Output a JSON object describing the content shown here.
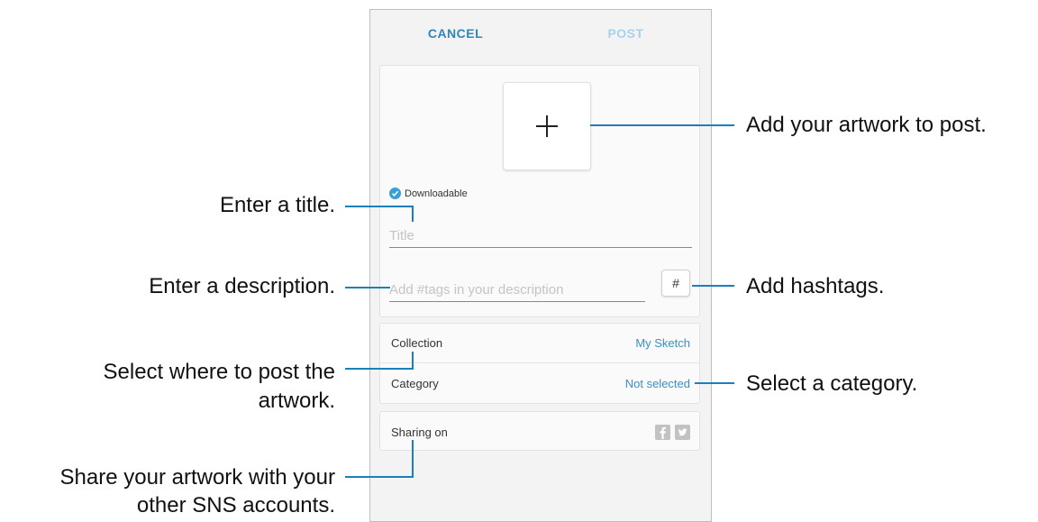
{
  "toolbar": {
    "cancel_label": "CANCEL",
    "post_label": "POST"
  },
  "form": {
    "add_icon": "plus-icon",
    "downloadable_label": "Downloadable",
    "downloadable_checked": true,
    "title_placeholder": "Title",
    "description_placeholder": "Add #tags in your description",
    "hashtag_button_label": "#"
  },
  "settings": {
    "collection_label": "Collection",
    "collection_value": "My Sketch",
    "category_label": "Category",
    "category_value": "Not selected",
    "sharing_label": "Sharing on",
    "sharing_icons": [
      "facebook-icon",
      "twitter-icon"
    ]
  },
  "callouts": {
    "add_artwork": "Add your artwork to post.",
    "enter_title": "Enter a title.",
    "enter_description": "Enter a description.",
    "add_hashtags": "Add hashtags.",
    "select_where_line1": "Select where to post the",
    "select_where_line2": "artwork.",
    "select_category": "Select a category.",
    "share_line1": "Share your artwork with your",
    "share_line2": "other SNS accounts."
  },
  "colors": {
    "accent": "#2e86b9",
    "callout_line": "#1c7fba",
    "link_value": "#3a8fc9",
    "post_disabled": "#a6d3ea"
  }
}
